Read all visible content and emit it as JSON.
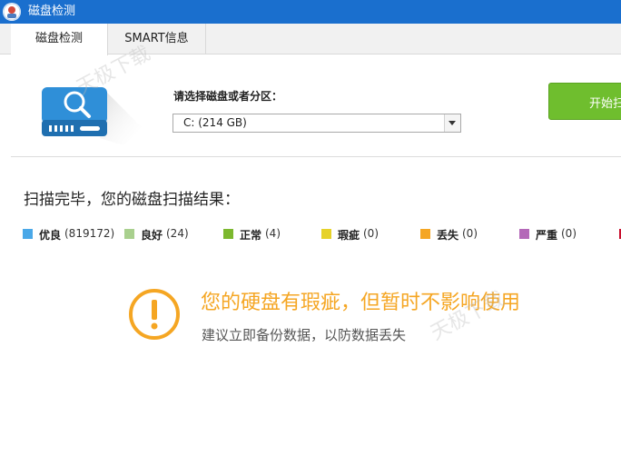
{
  "window": {
    "title": "磁盘检测"
  },
  "tabs": [
    {
      "label": "磁盘检测",
      "active": true
    },
    {
      "label": "SMART信息",
      "active": false
    }
  ],
  "disk_select": {
    "label": "请选择磁盘或者分区：",
    "selected": "C:  (214 GB)"
  },
  "start_button": {
    "label": "开始扫描"
  },
  "scan": {
    "heading": "扫描完毕，您的磁盘扫描结果：",
    "legend": [
      {
        "label": "优良",
        "count": "(819172)",
        "color": "#4aa8e8"
      },
      {
        "label": "良好",
        "count": "(24)",
        "color": "#a9d08e"
      },
      {
        "label": "正常",
        "count": "(4)",
        "color": "#7cb82f"
      },
      {
        "label": "瑕疵",
        "count": "(0)",
        "color": "#e6d22a"
      },
      {
        "label": "丢失",
        "count": "(0)",
        "color": "#f5a623"
      },
      {
        "label": "严重",
        "count": "(0)",
        "color": "#b468b8"
      }
    ]
  },
  "result": {
    "title": "您的硬盘有瑕疵，但暂时不影响使用",
    "subtitle": "建议立即备份数据，以防数据丢失"
  },
  "watermark": {
    "text": "天极下载"
  },
  "colors": {
    "titlebar": "#1a6fce",
    "accent_green": "#6fbe2e",
    "warning": "#f5a623",
    "disk_blue": "#2f8fd8"
  },
  "icons": {
    "app": "app-logo-icon",
    "disk": "hard-disk-magnifier-icon",
    "dropdown": "chevron-down-icon",
    "warning": "exclamation-circle-icon"
  }
}
